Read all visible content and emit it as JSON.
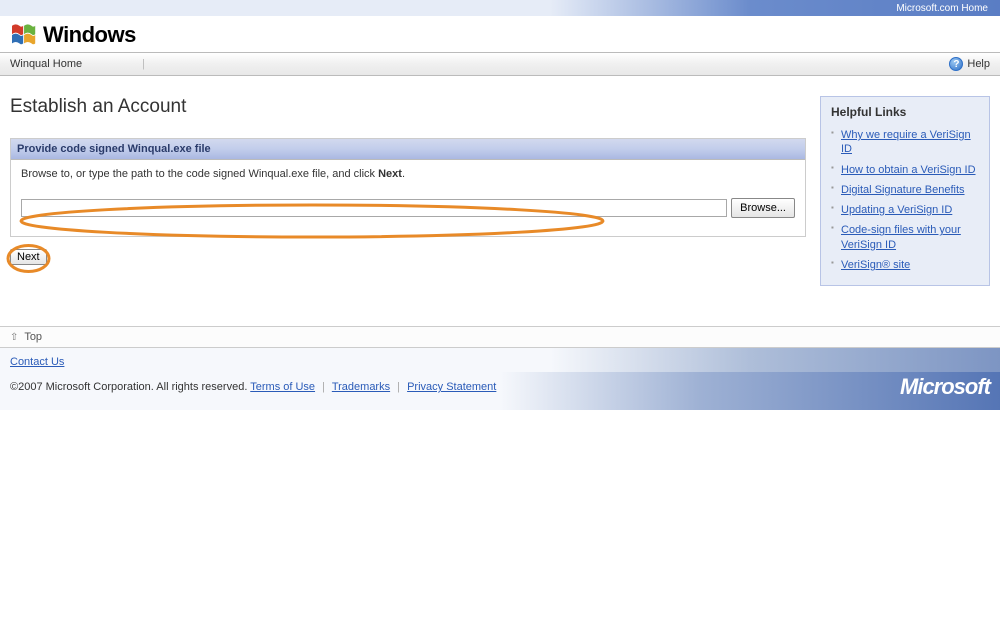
{
  "top": {
    "home_link": "Microsoft.com Home"
  },
  "brand": {
    "text": "Windows"
  },
  "nav": {
    "winqual_home": "Winqual Home",
    "help": "Help"
  },
  "page": {
    "title": "Establish an Account"
  },
  "panel": {
    "header": "Provide code signed Winqual.exe file",
    "instruction_pre": "Browse to, or type the path to the code signed Winqual.exe file, and click ",
    "instruction_bold": "Next",
    "instruction_post": ".",
    "browse_label": "Browse...",
    "file_value": ""
  },
  "next_label": "Next",
  "sidebar": {
    "title": "Helpful Links",
    "links": [
      "Why we require a VeriSign ID",
      "How to obtain a VeriSign ID",
      "Digital Signature Benefits",
      "Updating a VeriSign ID",
      "Code-sign files with your VeriSign ID",
      "VeriSign® site"
    ]
  },
  "footer": {
    "top_label": "Top",
    "contact": "Contact Us",
    "copyright": "©2007 Microsoft Corporation. All rights reserved.",
    "terms": "Terms of Use",
    "trademarks": "Trademarks",
    "privacy": "Privacy Statement",
    "ms_logo": "Microsoft"
  }
}
